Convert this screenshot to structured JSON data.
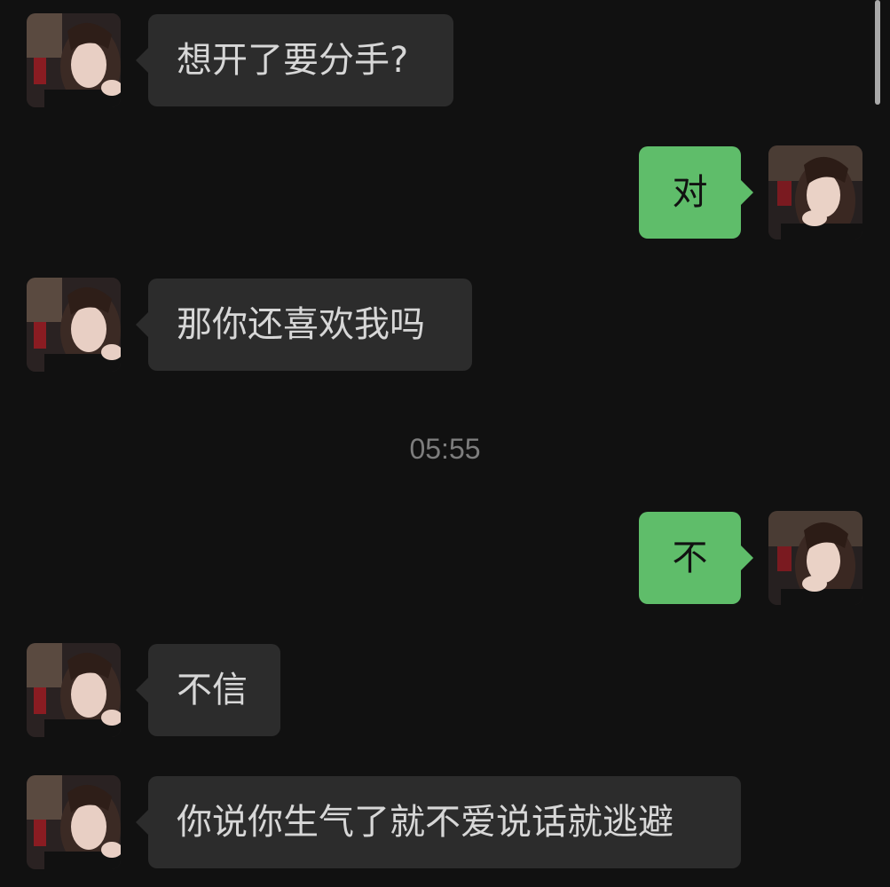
{
  "messages": [
    {
      "side": "in",
      "text": "想开了要分手?"
    },
    {
      "side": "out",
      "text": "对"
    },
    {
      "side": "in",
      "text": "那你还喜欢我吗"
    },
    {
      "side": "out",
      "text": "不"
    },
    {
      "side": "in",
      "text": "不信"
    },
    {
      "side": "in",
      "text": "你说你生气了就不爱说话就逃避"
    }
  ],
  "timestamp": "05:55",
  "colors": {
    "background": "#111111",
    "incoming_bubble": "#2c2c2c",
    "outgoing_bubble": "#5fbd6a",
    "incoming_text": "#d7d7d7",
    "outgoing_text": "#111111",
    "timestamp": "#7d7d7d"
  },
  "icons": {
    "contact_avatar": "contact-avatar-photo",
    "self_avatar": "self-avatar-photo"
  }
}
